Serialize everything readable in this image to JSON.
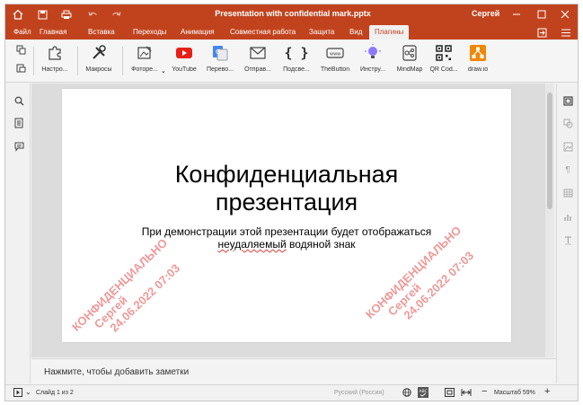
{
  "titlebar": {
    "title": "Presentation with confidential mark.pptx",
    "user": "Сергей",
    "icons": [
      "home-icon",
      "save-icon",
      "print-icon",
      "undo-icon",
      "redo-icon",
      "minimize-icon",
      "maximize-icon",
      "close-icon"
    ]
  },
  "menu": {
    "items": [
      "Файл",
      "Главная",
      "Вставка",
      "Переходы",
      "Анимация",
      "Совместная работа",
      "Защита",
      "Вид",
      "Плагины"
    ],
    "active": "Плагины"
  },
  "toolbar": {
    "tools": [
      {
        "label": "Настро...",
        "icon": "puzzle-icon"
      },
      {
        "label": "Макросы",
        "icon": "tools-icon"
      },
      {
        "label": "Фоторе...",
        "icon": "photo-editor-icon"
      },
      {
        "label": "YouTube",
        "icon": "youtube-icon"
      },
      {
        "label": "Перево...",
        "icon": "translate-icon"
      },
      {
        "label": "Отправ...",
        "icon": "mail-icon"
      },
      {
        "label": "Подсве...",
        "icon": "braces-icon"
      },
      {
        "label": "TheButton",
        "icon": "www-button-icon"
      },
      {
        "label": "Инстру...",
        "icon": "bulb-icon"
      },
      {
        "label": "MindMap",
        "icon": "mindmap-icon"
      },
      {
        "label": "QR Cod...",
        "icon": "qr-code-icon"
      },
      {
        "label": "draw.io",
        "icon": "drawio-icon"
      }
    ]
  },
  "slide": {
    "title_line1": "Конфиденциальная",
    "title_line2": "презентация",
    "subtitle_line1": "При демонстрации этой презентации будет отображаться",
    "subtitle_word_underlined": "неудаляемый",
    "subtitle_rest": " водяной знак"
  },
  "watermark": {
    "line1": "КОНФИДЕНЦИАЛЬНО",
    "line2": "Сергей",
    "line3": "24.06.2022 07:03",
    "color": "#e14646"
  },
  "notes": {
    "placeholder": "Нажмите, чтобы добавить заметки"
  },
  "status": {
    "slide_info": "Слайд 1 из 2",
    "language": "Русский (Россия)",
    "zoom": "Масштаб 59%"
  },
  "colors": {
    "accent": "#c1431e"
  }
}
